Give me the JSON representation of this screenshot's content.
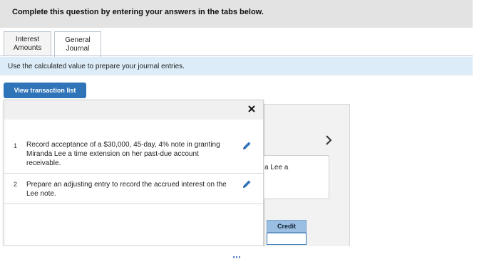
{
  "header": {
    "text": "Complete this question by entering your answers in the tabs below."
  },
  "tabs": [
    {
      "line1": "Interest",
      "line2": "Amounts"
    },
    {
      "line1": "General",
      "line2": "Journal"
    }
  ],
  "instruction": "Use the calculated value to prepare your journal entries.",
  "view_button": "View transaction list",
  "background": {
    "text_fragment": "a Lee a",
    "credit_header": "Credit"
  },
  "popup": {
    "close_glyph": "✕",
    "transactions": [
      {
        "number": "1",
        "text": "Record acceptance of a $30,000, 45-day, 4% note in granting Miranda Lee a time extension on her past-due account receivable."
      },
      {
        "number": "2",
        "text": "Prepare an adjusting entry to record the accrued interest on the Lee note."
      }
    ]
  },
  "icons": {
    "edit": "pencil-icon",
    "close": "close-icon",
    "next": "chevron-right-icon"
  },
  "colors": {
    "accent": "#2f74b8",
    "instruction_bg": "#dcecf8",
    "header_bg": "#e3e3e3"
  }
}
